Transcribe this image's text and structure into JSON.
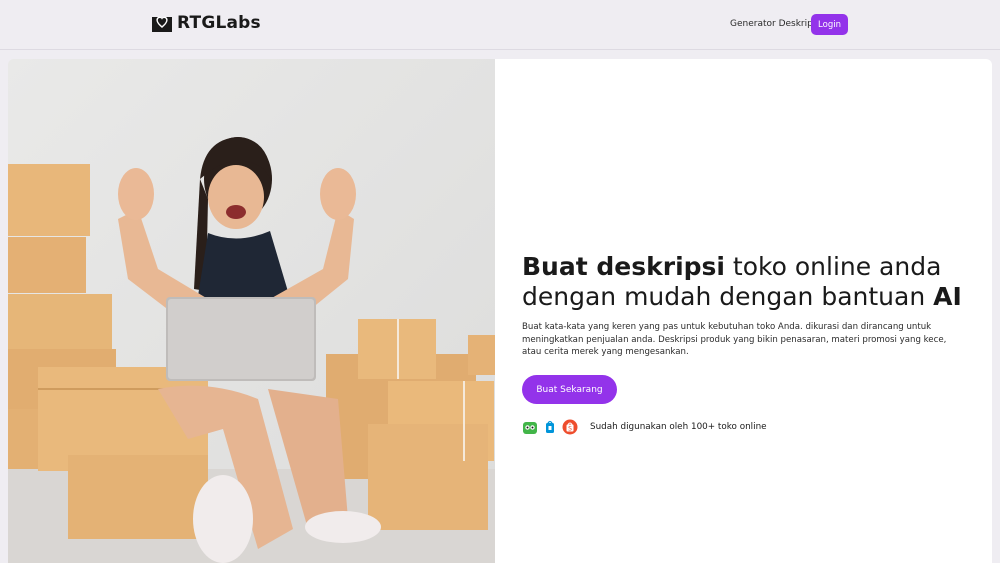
{
  "header": {
    "brand": "RTGLabs",
    "logo_icon": "heart-box-icon",
    "nav_link": "Generator Deskripsi",
    "login_label": "Login"
  },
  "hero": {
    "headline_bold_1": "Buat deskripsi",
    "headline_mid": " toko online anda dengan mudah dengan bantuan ",
    "headline_bold_2": "AI",
    "description": "Buat kata-kata yang keren yang pas untuk kebutuhan toko Anda. dikurasi dan dirancang untuk meningkatkan penjualan anda. Deskripsi produk yang bikin penasaran, materi promosi yang kece, atau cerita merek yang mengesankan.",
    "cta_label": "Buat Sekarang",
    "social_proof": "Sudah digunakan oleh 100+ toko online",
    "marketplace_icons": [
      "tokopedia-icon",
      "blibli-icon",
      "shopee-icon"
    ],
    "image_subject": "hero-photo"
  },
  "colors": {
    "accent": "#9333ea",
    "background": "#efedf2",
    "panel": "#ffffff"
  }
}
